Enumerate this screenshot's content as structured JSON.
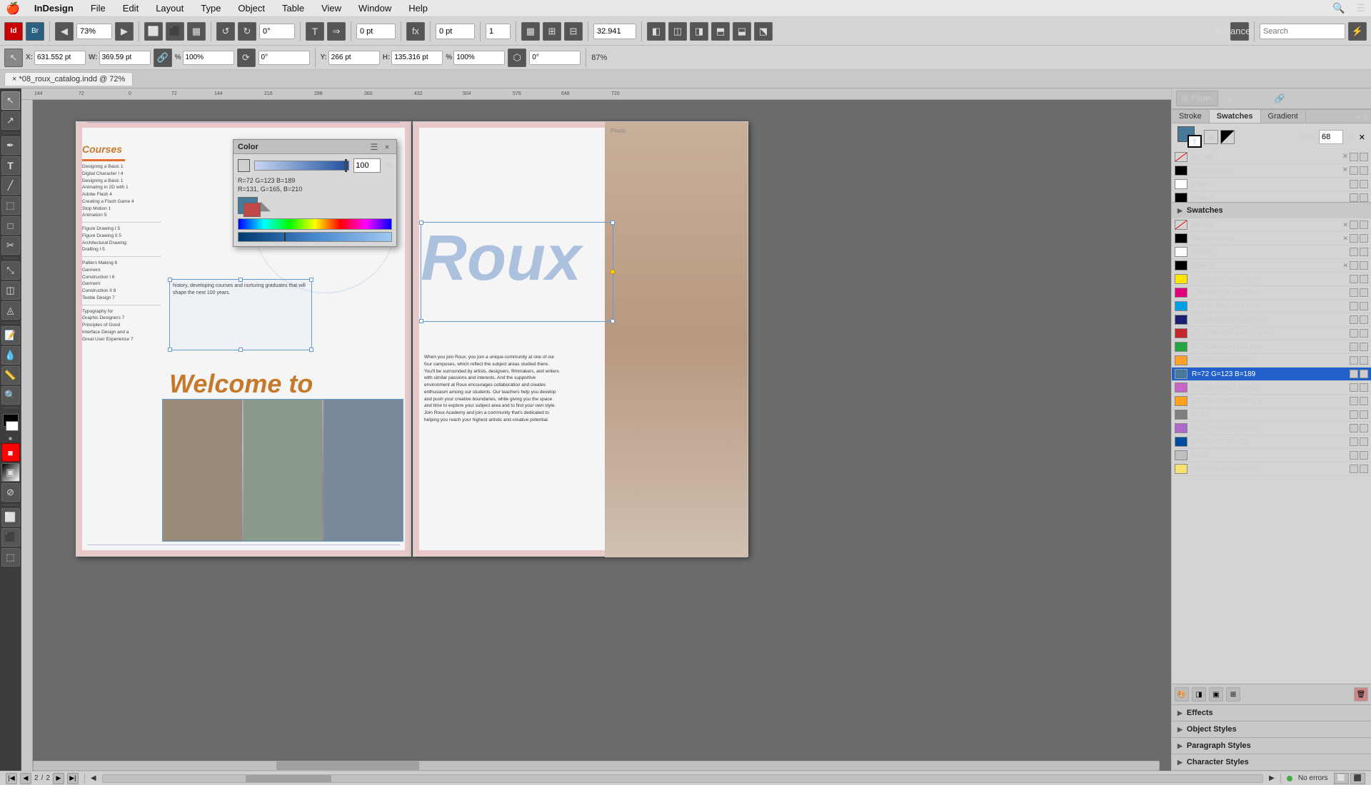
{
  "app": {
    "name": "InDesign",
    "title": "*08_roux_catalog.indd @ 72%"
  },
  "menubar": {
    "apple": "🍎",
    "items": [
      "InDesign",
      "File",
      "Edit",
      "Layout",
      "Type",
      "Object",
      "Table",
      "View",
      "Window",
      "Help"
    ]
  },
  "toolbar": {
    "br_btn": "Br",
    "zoom_value": "73%",
    "workspace": "Advanced",
    "search_placeholder": "Search"
  },
  "coords": {
    "x_label": "X:",
    "x_value": "631.552 pt",
    "y_label": "Y:",
    "y_value": "266 pt",
    "w_label": "W:",
    "w_value": "369.59 pt",
    "h_label": "H:",
    "h_value": "135.316 pt",
    "scale_w": "100%",
    "scale_h": "100%",
    "rotate": "0°",
    "shear": "0°"
  },
  "tab": {
    "label": "*08_roux_catalog.indd @ 72%"
  },
  "top_panel": {
    "stroke_tab": "Stroke",
    "swatches_tab": "Swatches",
    "gradient_tab": "Gradient",
    "tint_label": "Tint:",
    "tint_value": "68",
    "tint_percent": "%"
  },
  "swatches": {
    "title": "Swatches",
    "items": [
      {
        "name": "[None]",
        "color": "transparent",
        "r": 0,
        "g": 0,
        "b": 0,
        "has_x": true,
        "selected": false
      },
      {
        "name": "[Registration]",
        "color": "#000",
        "r": 0,
        "g": 0,
        "b": 0,
        "has_x": true,
        "selected": false
      },
      {
        "name": "[Paper]",
        "color": "#fff",
        "r": 255,
        "g": 255,
        "b": 255,
        "has_x": false,
        "selected": false
      },
      {
        "name": "[Black]",
        "color": "#000",
        "r": 0,
        "g": 0,
        "b": 0,
        "has_x": true,
        "selected": false
      },
      {
        "name": "C=0 M=0 Y=100 K=0",
        "color": "#ffe600",
        "r": 255,
        "g": 230,
        "b": 0,
        "has_x": false,
        "selected": false
      },
      {
        "name": "C=0 M=100 Y=0 K=0",
        "color": "#e2007a",
        "r": 226,
        "g": 0,
        "b": 122,
        "has_x": false,
        "selected": false
      },
      {
        "name": "C=100 M=0 Y=0 K=0",
        "color": "#009ee3",
        "r": 0,
        "g": 158,
        "b": 227,
        "has_x": false,
        "selected": false
      },
      {
        "name": "C=100 M=90 Y=10 K=0",
        "color": "#1a1f6e",
        "r": 26,
        "g": 31,
        "b": 110,
        "has_x": false,
        "selected": false
      },
      {
        "name": "C=15 M=100 Y=100 K=0",
        "color": "#c1272d",
        "r": 193,
        "g": 39,
        "b": 45,
        "has_x": false,
        "selected": false
      },
      {
        "name": "C=75 M=5 Y=100 K=0",
        "color": "#26a541",
        "r": 38,
        "g": 165,
        "b": 65,
        "has_x": false,
        "selected": false
      },
      {
        "name": "R=255 G=160 B=42",
        "color": "#ffa02a",
        "r": 255,
        "g": 160,
        "b": 42,
        "has_x": false,
        "selected": false
      },
      {
        "name": "R=72 G=123 B=189",
        "color": "#48789a",
        "r": 72,
        "g": 123,
        "b": 189,
        "has_x": false,
        "selected": true
      },
      {
        "name": "R=198 G=102 B=201",
        "color": "#c666c9",
        "r": 198,
        "g": 102,
        "b": 201,
        "has_x": false,
        "selected": false
      },
      {
        "name": "R=255 G=160 B=31 1",
        "color": "#ffa01f",
        "r": 255,
        "g": 160,
        "b": 31,
        "has_x": false,
        "selected": false
      },
      {
        "name": "K=51",
        "color": "#7f7f7f",
        "r": 127,
        "g": 127,
        "b": 127,
        "has_x": false,
        "selected": false
      },
      {
        "name": "R=177 G=105 B=201",
        "color": "#b169c9",
        "r": 177,
        "g": 105,
        "b": 201,
        "has_x": false,
        "selected": false
      },
      {
        "name": "R=0 G=76 B=159",
        "color": "#004c9f",
        "r": 0,
        "g": 76,
        "b": 159,
        "has_x": false,
        "selected": false
      },
      {
        "name": "K=25",
        "color": "#bfbfbf",
        "r": 191,
        "g": 191,
        "b": 191,
        "has_x": false,
        "selected": false
      },
      {
        "name": "R=248 G=225 B=111",
        "color": "#f8e16f",
        "r": 248,
        "g": 225,
        "b": 111,
        "has_x": false,
        "selected": false
      }
    ]
  },
  "color_dialog": {
    "title": "Color",
    "slider_value": "100",
    "text1": "R=72 G=123 B=189",
    "text2": "R=131, G=165, B=210",
    "preview_color1": "#48789a",
    "preview_color2": "#8395bb"
  },
  "panels": {
    "pages_label": "Pages",
    "layers_label": "Layers",
    "links_label": "Links",
    "stroke_label": "Stroke",
    "swatches_label": "Swatches",
    "gradient_label": "Gradient",
    "effects_label": "Effects",
    "object_styles_label": "Object Styles",
    "paragraph_styles_label": "Paragraph Styles",
    "character_styles_label": "Character Styles"
  },
  "document": {
    "zoom": "72%",
    "courses_title": "Courses",
    "welcome_text": "Welcome to",
    "roux_text": "Roux",
    "page_num": "2",
    "total_pages": "2",
    "status": "No errors",
    "courses": [
      "Designing a Basic 1",
      "Digital Character I 4",
      "Designing a Basic 1",
      "Animating in 2D with 1",
      "Adobe Flash 4",
      "Creating a Flash Game 4",
      "Stop Motion 1",
      "Animation 5",
      "",
      "Figure Drawing I 5",
      "Figure Drawing II 5",
      "Architectural Drawing:",
      "Drafting I 5",
      "",
      "Pattern Making 6",
      "Garment",
      "Construction I 6",
      "Garment",
      "Construction II 6",
      "Textile Design 7",
      "",
      "Typography for",
      "Graphic Designers 7",
      "Principles of Good",
      "Interface Design and a",
      "Great User Experience 7"
    ],
    "body_text": "When you join Roux, you join a unique community at one of our four campuses, which reflect the subject areas studied there. You'll be surrounded by artists, designers, filmmakers, and writers with similar passions and interests. And the supportive environment at Roux encourages collaboration and creates enthusiasm among our students. Our teachers help you develop and push your creative boundaries, while giving you the space and time to explore your subject area and to find your own style. Join Roux Academy and join a community that's dedicated to helping you reach your highest artistic and creative potential."
  }
}
